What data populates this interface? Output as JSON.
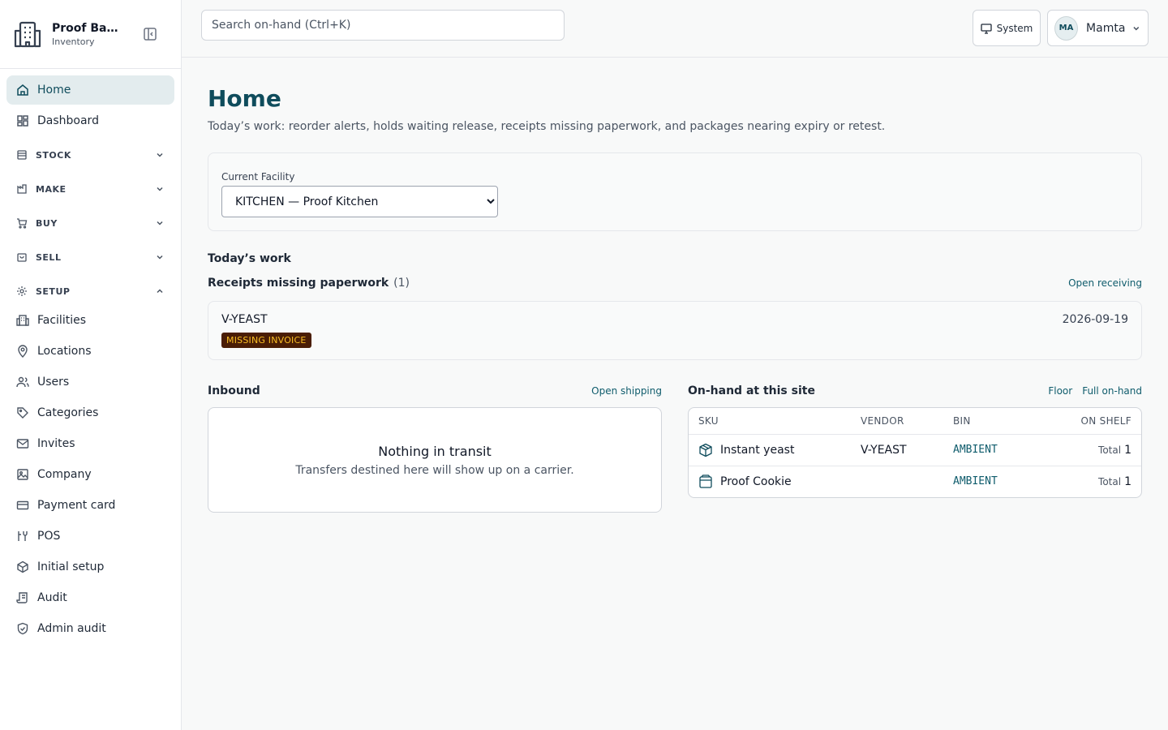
{
  "brand": {
    "name": "Proof Bak...",
    "subtitle": "Inventory"
  },
  "sidebar": {
    "top_items": [
      {
        "label": "Home",
        "icon": "home-icon"
      },
      {
        "label": "Dashboard",
        "icon": "dashboard-icon"
      }
    ],
    "groups": [
      {
        "label": "STOCK",
        "icon": "stock-icon",
        "expanded": false
      },
      {
        "label": "MAKE",
        "icon": "make-icon",
        "expanded": false
      },
      {
        "label": "BUY",
        "icon": "cart-icon",
        "expanded": false
      },
      {
        "label": "SELL",
        "icon": "bag-icon",
        "expanded": false
      },
      {
        "label": "SETUP",
        "icon": "gear-icon",
        "expanded": true
      }
    ],
    "setup_items": [
      {
        "label": "Facilities",
        "icon": "building-icon"
      },
      {
        "label": "Locations",
        "icon": "map-pin-icon"
      },
      {
        "label": "Users",
        "icon": "users-icon"
      },
      {
        "label": "Categories",
        "icon": "tag-icon"
      },
      {
        "label": "Invites",
        "icon": "mail-icon"
      },
      {
        "label": "Company",
        "icon": "image-icon"
      },
      {
        "label": "Payment card",
        "icon": "credit-card-icon"
      },
      {
        "label": "POS",
        "icon": "pos-icon"
      },
      {
        "label": "Initial setup",
        "icon": "setup-icon"
      },
      {
        "label": "Audit",
        "icon": "audit-icon"
      },
      {
        "label": "Admin audit",
        "icon": "shield-icon"
      }
    ]
  },
  "topbar": {
    "search_placeholder": "Search on-hand (Ctrl+K)",
    "theme_label": "System",
    "user_initials": "MA",
    "user_name": "Mamta"
  },
  "page": {
    "title": "Home",
    "description": "Today’s work: reorder alerts, holds waiting release, receipts missing paperwork, and packages nearing expiry or retest."
  },
  "facility": {
    "label": "Current Facility",
    "selected": "KITCHEN — Proof Kitchen"
  },
  "today": {
    "title": "Today’s work",
    "receipts_title": "Receipts missing paperwork",
    "receipts_count": "(1)",
    "receipts_link": "Open receiving",
    "receipt": {
      "vendor": "V-YEAST",
      "date": "2026-09-19",
      "badge": "MISSING INVOICE"
    }
  },
  "inbound": {
    "title": "Inbound",
    "link": "Open shipping",
    "empty_title": "Nothing in transit",
    "empty_sub": "Transfers destined here will show up on a carrier."
  },
  "onhand": {
    "title": "On-hand at this site",
    "links": [
      "Floor",
      "Full on-hand"
    ],
    "columns": [
      "SKU",
      "VENDOR",
      "BIN",
      "ON SHELF"
    ],
    "rows": [
      {
        "sku": "Instant yeast",
        "icon": "package-icon",
        "vendor": "V-YEAST",
        "bin": "AMBIENT",
        "total_label": "Total",
        "total": "1"
      },
      {
        "sku": "Proof Cookie",
        "icon": "box-icon",
        "vendor": "",
        "bin": "AMBIENT",
        "total_label": "Total",
        "total": "1"
      }
    ]
  }
}
